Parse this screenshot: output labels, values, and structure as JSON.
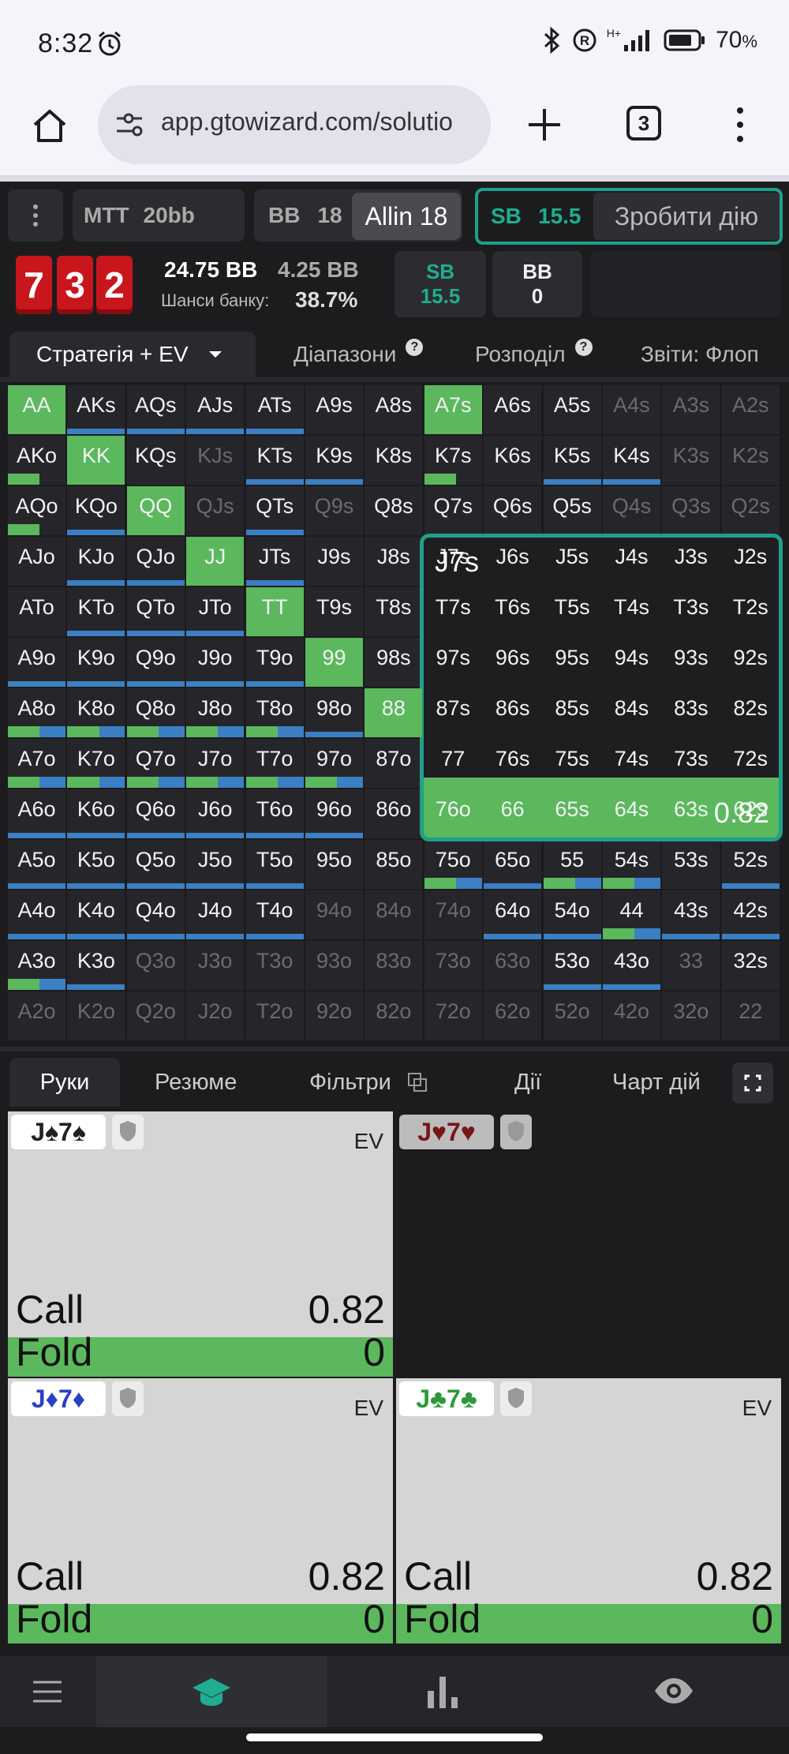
{
  "status": {
    "time": "8:32",
    "battery": "70",
    "battery_unit": "%",
    "network": "H+"
  },
  "browser": {
    "url": "app.gtowizard.com/solutio",
    "tab_count": "3"
  },
  "topbar": {
    "mtt": "MTT",
    "stack": "20bb",
    "bb_label": "BB",
    "bb_value": "18",
    "allin": "Allin 18",
    "sb_label": "SB",
    "sb_value": "15.5",
    "action_button": "Зробити дію"
  },
  "board": {
    "cards": [
      "7",
      "3",
      "2"
    ]
  },
  "pot": {
    "total": "24.75 BB",
    "secondary": "4.25 BB",
    "odds_label": "Шанси банку:",
    "odds_value": "38.7%"
  },
  "players": [
    {
      "name": "SB",
      "stack": "15.5",
      "color": "#1fae8f"
    },
    {
      "name": "BB",
      "stack": "0",
      "color": "#f0f0f0"
    }
  ],
  "tabs": [
    {
      "label": "Стратегія + EV"
    },
    {
      "label": "Діапазони"
    },
    {
      "label": "Розподіл"
    },
    {
      "label": "Звіти: Флоп"
    }
  ],
  "grid": {
    "rows": [
      [
        "AA",
        "AKs",
        "AQs",
        "AJs",
        "ATs",
        "A9s",
        "A8s",
        "A7s",
        "A6s",
        "A5s",
        "A4s",
        "A3s",
        "A2s"
      ],
      [
        "AKo",
        "KK",
        "KQs",
        "KJs",
        "KTs",
        "K9s",
        "K8s",
        "K7s",
        "K6s",
        "K5s",
        "K4s",
        "K3s",
        "K2s"
      ],
      [
        "AQo",
        "KQo",
        "QQ",
        "QJs",
        "QTs",
        "Q9s",
        "Q8s",
        "Q7s",
        "Q6s",
        "Q5s",
        "Q4s",
        "Q3s",
        "Q2s"
      ],
      [
        "AJo",
        "KJo",
        "QJo",
        "JJ",
        "JTs",
        "J9s",
        "J8s",
        "J7s",
        "J6s",
        "J5s",
        "J4s",
        "J3s",
        "J2s"
      ],
      [
        "ATo",
        "KTo",
        "QTo",
        "JTo",
        "TT",
        "T9s",
        "T8s",
        "T7s",
        "T6s",
        "T5s",
        "T4s",
        "T3s",
        "T2s"
      ],
      [
        "A9o",
        "K9o",
        "Q9o",
        "J9o",
        "T9o",
        "99",
        "98s",
        "97s",
        "96s",
        "95s",
        "94s",
        "93s",
        "92s"
      ],
      [
        "A8o",
        "K8o",
        "Q8o",
        "J8o",
        "T8o",
        "98o",
        "88",
        "87s",
        "86s",
        "85s",
        "84s",
        "83s",
        "82s"
      ],
      [
        "A7o",
        "K7o",
        "Q7o",
        "J7o",
        "T7o",
        "97o",
        "87o",
        "77",
        "76s",
        "75s",
        "74s",
        "73s",
        "72s"
      ],
      [
        "A6o",
        "K6o",
        "Q6o",
        "J6o",
        "T6o",
        "96o",
        "86o",
        "76o",
        "66",
        "65s",
        "64s",
        "63s",
        "62s"
      ],
      [
        "A5o",
        "K5o",
        "Q5o",
        "J5o",
        "T5o",
        "95o",
        "85o",
        "75o",
        "65o",
        "55",
        "54s",
        "53s",
        "52s"
      ],
      [
        "A4o",
        "K4o",
        "Q4o",
        "J4o",
        "T4o",
        "94o",
        "84o",
        "74o",
        "64o",
        "54o",
        "44",
        "43s",
        "42s"
      ],
      [
        "A3o",
        "K3o",
        "Q3o",
        "J3o",
        "T3o",
        "93o",
        "83o",
        "73o",
        "63o",
        "53o",
        "43o",
        "33",
        "32s"
      ],
      [
        "A2o",
        "K2o",
        "Q2o",
        "J2o",
        "T2o",
        "92o",
        "82o",
        "72o",
        "62o",
        "52o",
        "42o",
        "32o",
        "22"
      ]
    ],
    "dim": [
      "A4s",
      "A3s",
      "A2s",
      "KJs",
      "K3s",
      "K2s",
      "QJs",
      "Q9s",
      "Q4s",
      "Q3s",
      "Q2s",
      "94o",
      "84o",
      "74o",
      "Q3o",
      "J3o",
      "T3o",
      "93o",
      "83o",
      "73o",
      "63o",
      "33",
      "A2o",
      "K2o",
      "Q2o",
      "J2o",
      "T2o",
      "92o",
      "82o",
      "72o",
      "62o",
      "52o",
      "42o",
      "32o",
      "22"
    ],
    "full_green": [
      "AA",
      "KK",
      "QQ",
      "JJ",
      "TT",
      "99",
      "88",
      "A7s"
    ]
  },
  "popup": {
    "hand": "J7s",
    "value": "0.82"
  },
  "bottom_tabs": [
    {
      "label": "Руки"
    },
    {
      "label": "Резюме"
    },
    {
      "label": "Фільтри"
    },
    {
      "label": "Дії"
    },
    {
      "label": "Чарт дій"
    }
  ],
  "hands": [
    {
      "card": "J♠7♠",
      "color": "#222222",
      "ev": "EV",
      "call_label": "Call",
      "call_value": "0.82",
      "fold_label": "Fold",
      "fold_value": "0",
      "fold_pct": 1
    },
    {
      "card": "J♥7♥",
      "color": "#7a1515",
      "ev": "",
      "call_label": "",
      "call_value": "",
      "fold_label": "",
      "fold_value": "",
      "fold_pct": 0
    },
    {
      "card": "J♦7♦",
      "color": "#2b3fc7",
      "ev": "EV",
      "call_label": "Call",
      "call_value": "0.82",
      "fold_label": "Fold",
      "fold_value": "0",
      "fold_pct": 1
    },
    {
      "card": "J♣7♣",
      "color": "#2a9a3a",
      "ev": "EV",
      "call_label": "Call",
      "call_value": "0.82",
      "fold_label": "Fold",
      "fold_value": "0",
      "fold_pct": 1
    }
  ],
  "colors": {
    "accent": "#1fa08a",
    "green": "#5bb85d",
    "blue": "#3b7fc4",
    "card_red": "#c9161c"
  }
}
